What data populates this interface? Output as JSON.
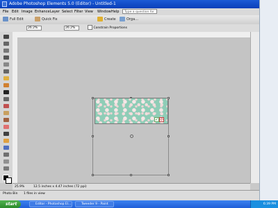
{
  "window": {
    "title": "Adobe Photoshop Elements 5.0 (Editor) - Untitled-1"
  },
  "menu": [
    "File",
    "Edit",
    "Image",
    "Enhance",
    "Layer",
    "Select",
    "Filter",
    "View",
    "Window",
    "Help"
  ],
  "help_search": {
    "placeholder": "Type a question for help"
  },
  "toolbar": {
    "full_edit": "Full Edit",
    "quick_fix": "Quick Fix",
    "create": "Create",
    "organize": "Orga..."
  },
  "options": {
    "w_value": "26.2%",
    "h_value": "26.2%",
    "constrain": "Constrain Proportions"
  },
  "status": {
    "zoom": "25.9%",
    "doc_info": "12.5 inches x 4.47 inches (72 ppi)"
  },
  "photo_bin": {
    "label": "Photo Bin",
    "files": "1 files in view"
  },
  "taskbar": {
    "start": "start",
    "tasks": [
      "Editor - Photoshop El...",
      "Tweeder 9 - Paint"
    ],
    "clock": "6:39 PM"
  }
}
